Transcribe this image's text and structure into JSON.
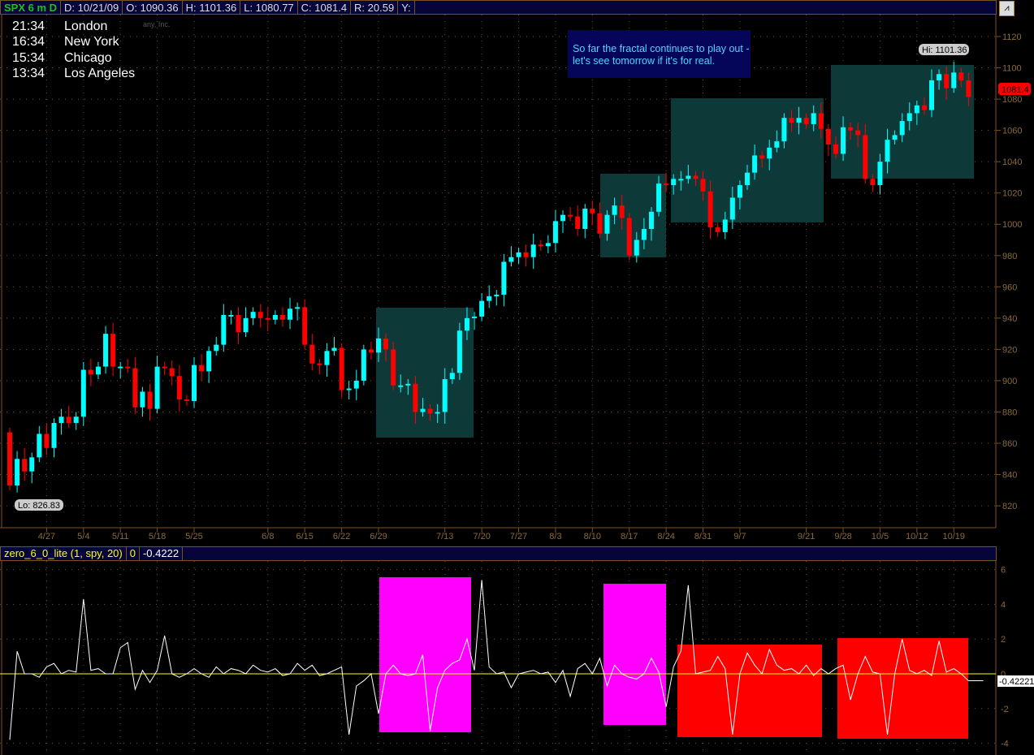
{
  "header": {
    "symbol": "SPX 6 m D",
    "date": "D: 10/21/09",
    "open": "O: 1090.36",
    "high": "H: 1101.36",
    "low": "L: 1080.77",
    "close": "C: 1081.4",
    "range": "R: 20.59",
    "y": "Y:"
  },
  "clocks": [
    {
      "time": "21:34",
      "city": "London"
    },
    {
      "time": "16:34",
      "city": "New York"
    },
    {
      "time": "15:34",
      "city": "Chicago"
    },
    {
      "time": "13:34",
      "city": "Los Angeles"
    }
  ],
  "watermark": "any, Inc.",
  "note": "So far the fractal continues to play out - let's see tomorrow if it's for real.",
  "indicator_header": {
    "name": "zero_6_0_lite (1, spy, 20)",
    "zero": "0",
    "value": "-0.4222"
  },
  "colors": {
    "up": "#00ffff",
    "down": "#ff0000",
    "box": "#0d3a38",
    "magenta": "#ff00ff",
    "red": "#ff0000"
  },
  "chart_data": [
    {
      "type": "candlestick",
      "title": "SPX 6 m D",
      "ylim": [
        810,
        1130
      ],
      "yticks": [
        820,
        840,
        860,
        880,
        900,
        920,
        940,
        960,
        980,
        1000,
        1020,
        1040,
        1060,
        1080,
        1100,
        1120
      ],
      "xticks": [
        {
          "i": 5,
          "label": "4/27"
        },
        {
          "i": 10,
          "label": "5/4"
        },
        {
          "i": 15,
          "label": "5/11"
        },
        {
          "i": 20,
          "label": "5/18"
        },
        {
          "i": 25,
          "label": "5/25"
        },
        {
          "i": 35,
          "label": "6/8"
        },
        {
          "i": 40,
          "label": "6/15"
        },
        {
          "i": 45,
          "label": "6/22"
        },
        {
          "i": 50,
          "label": "6/29"
        },
        {
          "i": 59,
          "label": "7/13"
        },
        {
          "i": 64,
          "label": "7/20"
        },
        {
          "i": 69,
          "label": "7/27"
        },
        {
          "i": 74,
          "label": "8/3"
        },
        {
          "i": 79,
          "label": "8/10"
        },
        {
          "i": 84,
          "label": "8/17"
        },
        {
          "i": 89,
          "label": "8/24"
        },
        {
          "i": 94,
          "label": "8/31"
        },
        {
          "i": 99,
          "label": "9/7"
        },
        {
          "i": 108,
          "label": "9/21"
        },
        {
          "i": 113,
          "label": "9/28"
        },
        {
          "i": 118,
          "label": "10/5"
        },
        {
          "i": 123,
          "label": "10/12"
        },
        {
          "i": 128,
          "label": "10/19"
        }
      ],
      "first_open": 867,
      "closes": [
        833,
        850,
        842,
        851,
        866,
        857,
        873,
        877,
        873,
        877,
        907,
        904,
        909,
        930,
        909,
        909,
        908,
        883,
        893,
        882,
        909,
        908,
        903,
        888,
        887,
        910,
        906,
        919,
        923,
        942,
        942,
        931,
        940,
        944,
        940,
        939,
        942,
        939,
        946,
        947,
        923,
        911,
        910,
        919,
        921,
        894,
        895,
        900,
        920,
        918,
        927,
        920,
        897,
        897,
        898,
        880,
        882,
        879,
        880,
        901,
        905,
        932,
        940,
        941,
        951,
        954,
        955,
        976,
        979,
        982,
        979,
        987,
        986,
        988,
        1002,
        1006,
        1005,
        997,
        1010,
        1007,
        994,
        1006,
        1012,
        1004,
        980,
        990,
        997,
        1008,
        1026,
        1025,
        1029,
        1029,
        1031,
        1029,
        1021,
        998,
        995,
        1003,
        1017,
        1025,
        1033,
        1044,
        1042,
        1049,
        1053,
        1068,
        1065,
        1068,
        1064,
        1071,
        1061,
        1051,
        1045,
        1062,
        1060,
        1057,
        1029,
        1025,
        1040,
        1054,
        1057,
        1066,
        1071,
        1076,
        1073,
        1092,
        1096,
        1087,
        1097,
        1092,
        1081.4
      ],
      "lo_label": "Lo: 826.83",
      "hi_label": "Hi: 1101.36",
      "last_label": "1081.4"
    },
    {
      "type": "line",
      "title": "zero_6_0_lite (1, spy, 20)",
      "ylim": [
        -4.3,
        6.3
      ],
      "yticks": [
        6,
        4,
        2,
        0,
        -2,
        -4
      ],
      "last_label": "-0.42221",
      "values": [
        -3.8,
        1.3,
        0,
        0,
        -0.2,
        0.4,
        0.6,
        0,
        0.2,
        0.1,
        4.3,
        0.2,
        0.3,
        0,
        0,
        1.5,
        1.8,
        -0.9,
        0.2,
        -0.5,
        0.2,
        2.2,
        0,
        -0.2,
        0,
        0.3,
        0,
        -0.2,
        0.4,
        0,
        0.3,
        0.2,
        0,
        0.5,
        0.2,
        0.1,
        0.3,
        -0.1,
        0,
        0.6,
        0.2,
        0.5,
        -0.1,
        0,
        0.2,
        0.4,
        -3.5,
        -0.7,
        -0.4,
        0,
        -2.3,
        0,
        0.5,
        0,
        -0.1,
        0,
        1.1,
        -3.3,
        -0.8,
        0.2,
        0.6,
        0.8,
        2,
        0.2,
        5.4,
        0.4,
        0,
        0.1,
        -0.8,
        0,
        0.1,
        0.2,
        0,
        0.1,
        -0.5,
        0.2,
        -1.3,
        0.3,
        0.6,
        0,
        0.9,
        -0.7,
        0.5,
        0,
        -0.2,
        -0.3,
        0,
        0.9,
        0.1,
        -1.9,
        0.4,
        1.3,
        5.1,
        0,
        0.1,
        0.2,
        1,
        0.3,
        -3.5,
        0,
        1.2,
        0.5,
        0,
        1.4,
        0.5,
        0.2,
        0.3,
        0,
        0.5,
        -0.1,
        0.3,
        0,
        0.3,
        0.5,
        -1.5,
        0,
        1,
        0.1,
        0,
        -3.5,
        0,
        2,
        0.2,
        0,
        0.2,
        -0.1,
        1.9,
        0.1,
        0.3,
        0,
        -0.4,
        -0.4,
        -0.4
      ]
    }
  ]
}
